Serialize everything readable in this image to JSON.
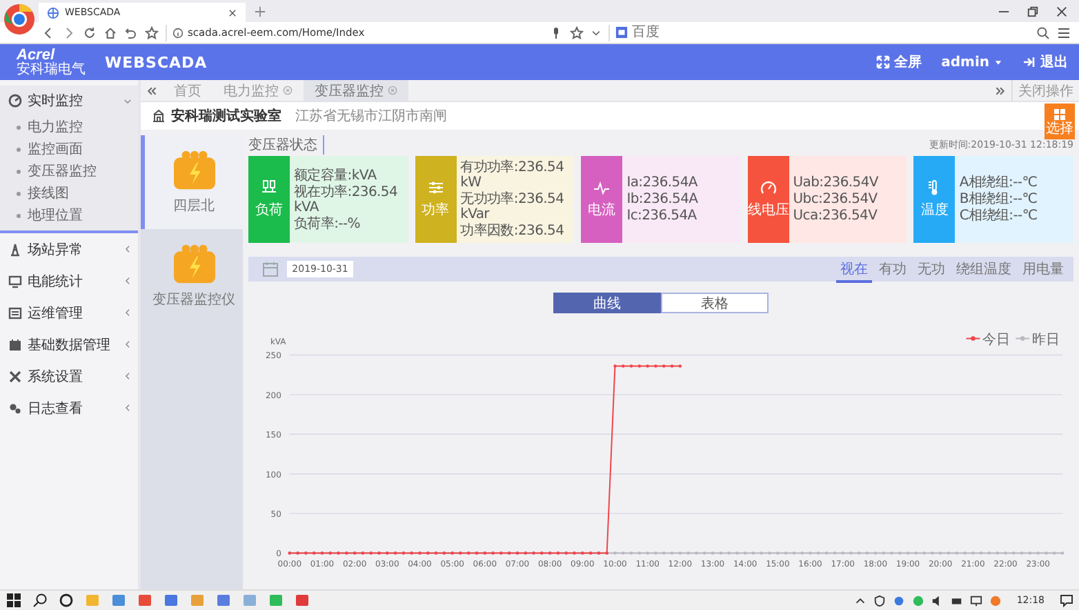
{
  "browser": {
    "tab_title": "WEBSCADA",
    "url": "scada.acrel-eem.com/Home/Index",
    "search_placeholder": "百度"
  },
  "header": {
    "logo": "Acrel",
    "logo_subtitle": "安科瑞电气",
    "app_name": "WEBSCADA",
    "fullscreen": "全屏",
    "user": "admin",
    "logout": "退出"
  },
  "page_tabs": [
    {
      "label": "首页",
      "selected": false
    },
    {
      "label": "电力监控",
      "selected": false
    },
    {
      "label": "变压器监控",
      "selected": true
    }
  ],
  "close_tabs": "关闭操作",
  "sidebar": [
    {
      "label": "实时监控",
      "expanded": true,
      "children": [
        {
          "label": "电力监控"
        },
        {
          "label": "监控画面"
        },
        {
          "label": "变压器监控"
        },
        {
          "label": "接线图"
        },
        {
          "label": "地理位置"
        }
      ]
    },
    {
      "label": "场站异常",
      "expanded": false
    },
    {
      "label": "电能统计",
      "expanded": false
    },
    {
      "label": "运维管理",
      "expanded": false
    },
    {
      "label": "基础数据管理",
      "expanded": false
    },
    {
      "label": "系统设置",
      "expanded": false
    },
    {
      "label": "日志查看",
      "expanded": false
    }
  ],
  "site": {
    "name": "安科瑞测试实验室",
    "address": "江苏省无锡市江阴市南闸",
    "select_button": "选择"
  },
  "transformers": [
    {
      "name": "四层北",
      "selected": true
    },
    {
      "name": "变压器监控仪",
      "selected": false
    }
  ],
  "status_title": "变压器状态",
  "update_time": "更新时间:2019-10-31 12:18:19",
  "cards": [
    {
      "label": "负荷",
      "color": "#1bbc4b",
      "lines": [
        "额定容量:kVA",
        "视在功率:236.54kVA",
        "负荷率:--%"
      ]
    },
    {
      "label": "功率",
      "color": "#cfb21f",
      "lines": [
        "有功功率:236.54kW",
        "无功功率:236.54kVar",
        "功率因数:236.54"
      ]
    },
    {
      "label": "电流",
      "color": "#d660c0",
      "lines": [
        "Ia:236.54A",
        "Ib:236.54A",
        "Ic:236.54A"
      ]
    },
    {
      "label": "线电压",
      "color": "#f5533d",
      "lines": [
        "Uab:236.54V",
        "Ubc:236.54V",
        "Uca:236.54V"
      ]
    },
    {
      "label": "温度",
      "color": "#27aaf5",
      "lines": [
        "A相绕组:--℃",
        "B相绕组:--℃",
        "C相绕组:--℃"
      ]
    }
  ],
  "date": "2019-10-31",
  "metric_tabs": [
    {
      "label": "视在",
      "selected": true
    },
    {
      "label": "有功",
      "selected": false
    },
    {
      "label": "无功",
      "selected": false
    },
    {
      "label": "绕组温度",
      "selected": false
    },
    {
      "label": "用电量",
      "selected": false
    }
  ],
  "view_toggle": [
    {
      "label": "曲线",
      "selected": true
    },
    {
      "label": "表格",
      "selected": false
    }
  ],
  "chart_data": {
    "type": "line",
    "ylabel": "kVA",
    "ylim": [
      0,
      250
    ],
    "yticks": [
      0,
      50,
      100,
      150,
      200,
      250
    ],
    "grid": true,
    "legend": true,
    "xlim": [
      0,
      23.75
    ],
    "x": [
      0,
      0.25,
      0.5,
      0.75,
      1,
      1.25,
      1.5,
      1.75,
      2,
      2.25,
      2.5,
      2.75,
      3,
      3.25,
      3.5,
      3.75,
      4,
      4.25,
      4.5,
      4.75,
      5,
      5.25,
      5.5,
      5.75,
      6,
      6.25,
      6.5,
      6.75,
      7,
      7.25,
      7.5,
      7.75,
      8,
      8.25,
      8.5,
      8.75,
      9,
      9.25,
      9.5,
      9.75,
      10,
      10.25,
      10.5,
      10.75,
      11,
      11.25,
      11.5,
      11.75,
      12,
      12.25,
      12.5,
      12.75,
      13,
      13.25,
      13.5,
      13.75,
      14,
      14.25,
      14.5,
      14.75,
      15,
      15.25,
      15.5,
      15.75,
      16,
      16.25,
      16.5,
      16.75,
      17,
      17.25,
      17.5,
      17.75,
      18,
      18.25,
      18.5,
      18.75,
      19,
      19.25,
      19.5,
      19.75,
      20,
      20.25,
      20.5,
      20.75,
      21,
      21.25,
      21.5,
      21.75,
      22,
      22.25,
      22.5,
      22.75,
      23,
      23.25,
      23.5,
      23.75
    ],
    "xticks": [
      {
        "value": 0,
        "label": "00:00"
      },
      {
        "value": 1,
        "label": "01:00"
      },
      {
        "value": 2,
        "label": "02:00"
      },
      {
        "value": 3,
        "label": "03:00"
      },
      {
        "value": 4,
        "label": "04:00"
      },
      {
        "value": 5,
        "label": "05:00"
      },
      {
        "value": 6,
        "label": "06:00"
      },
      {
        "value": 7,
        "label": "07:00"
      },
      {
        "value": 8,
        "label": "08:00"
      },
      {
        "value": 9,
        "label": "09:00"
      },
      {
        "value": 10,
        "label": "10:00"
      },
      {
        "value": 11,
        "label": "11:00"
      },
      {
        "value": 12,
        "label": "12:00"
      },
      {
        "value": 13,
        "label": "13:00"
      },
      {
        "value": 14,
        "label": "14:00"
      },
      {
        "value": 15,
        "label": "15:00"
      },
      {
        "value": 16,
        "label": "16:00"
      },
      {
        "value": 17,
        "label": "17:00"
      },
      {
        "value": 18,
        "label": "18:00"
      },
      {
        "value": 19,
        "label": "19:00"
      },
      {
        "value": 20,
        "label": "20:00"
      },
      {
        "value": 21,
        "label": "21:00"
      },
      {
        "value": 22,
        "label": "22:00"
      },
      {
        "value": 23,
        "label": "23:00"
      }
    ],
    "series": [
      {
        "name": "今日",
        "color": "#f0454a",
        "values": [
          0,
          0,
          0,
          0,
          0,
          0,
          0,
          0,
          0,
          0,
          0,
          0,
          0,
          0,
          0,
          0,
          0,
          0,
          0,
          0,
          0,
          0,
          0,
          0,
          0,
          0,
          0,
          0,
          0,
          0,
          0,
          0,
          0,
          0,
          0,
          0,
          0,
          0,
          0,
          0,
          236,
          236,
          236,
          236,
          236,
          236,
          236,
          236,
          236,
          null,
          null,
          null,
          null,
          null,
          null,
          null,
          null,
          null,
          null,
          null,
          null,
          null,
          null,
          null,
          null,
          null,
          null,
          null,
          null,
          null,
          null,
          null,
          null,
          null,
          null,
          null,
          null,
          null,
          null,
          null,
          null,
          null,
          null,
          null,
          null,
          null,
          null,
          null,
          null,
          null,
          null,
          null,
          null,
          null,
          null,
          null
        ]
      },
      {
        "name": "昨日",
        "color": "#b8b8c0",
        "values": [
          0,
          0,
          0,
          0,
          0,
          0,
          0,
          0,
          0,
          0,
          0,
          0,
          0,
          0,
          0,
          0,
          0,
          0,
          0,
          0,
          0,
          0,
          0,
          0,
          0,
          0,
          0,
          0,
          0,
          0,
          0,
          0,
          0,
          0,
          0,
          0,
          0,
          0,
          0,
          0,
          0,
          0,
          0,
          0,
          0,
          0,
          0,
          0,
          0,
          0,
          0,
          0,
          0,
          0,
          0,
          0,
          0,
          0,
          0,
          0,
          0,
          0,
          0,
          0,
          0,
          0,
          0,
          0,
          0,
          0,
          0,
          0,
          0,
          0,
          0,
          0,
          0,
          0,
          0,
          0,
          0,
          0,
          0,
          0,
          0,
          0,
          0,
          0,
          0,
          0,
          0,
          0,
          0,
          0,
          0,
          0
        ]
      }
    ]
  },
  "taskbar": {
    "time": "12:18"
  }
}
